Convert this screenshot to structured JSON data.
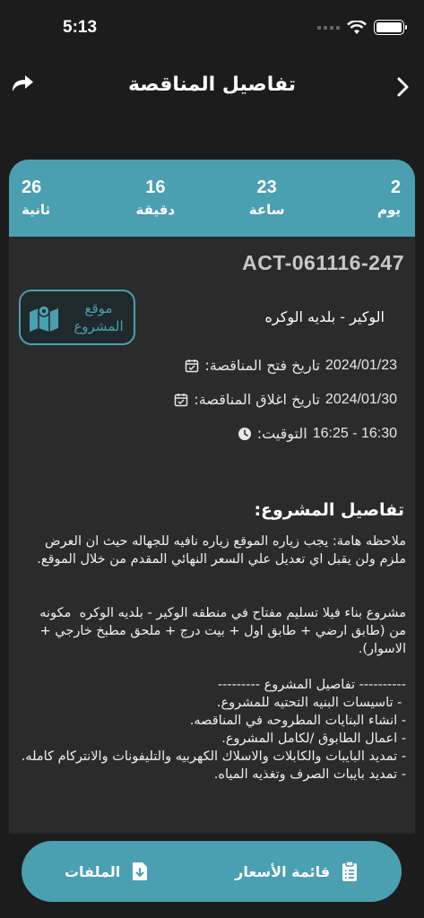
{
  "status": {
    "time": "5:13"
  },
  "nav": {
    "title": "تفاصيل المناقصة"
  },
  "countdown": [
    {
      "value": "2",
      "label": "يوم"
    },
    {
      "value": "23",
      "label": "ساعة"
    },
    {
      "value": "16",
      "label": "دقيقة"
    },
    {
      "value": "26",
      "label": "ثانية"
    }
  ],
  "tender": {
    "id": "ACT-061116-247",
    "location": "الوكير - بلديه الوكره",
    "map_button": "موقع المشروع",
    "open_date_label": "تاريخ فتح المناقصة:",
    "open_date": "2024/01/23",
    "close_date_label": "تاريخ اغلاق المناقصة:",
    "close_date": "2024/01/30",
    "timing_label": "التوقيت:",
    "timing": "16:25 - 16:30"
  },
  "details": {
    "title": "تفاصيل المشروع:",
    "body": "ملاحظه هامة: يجب زياره الموقع زياره نافيه للجهاله حيث ان العرض ملزم ولن يقبل اي تعديل علي السعر النهائي المقدم من خلال الموقع.\n\n\nمشروع بناء فيلا تسليم مفتاح في منطقه الوكير - بلديه الوكره  مكونه من (طابق ارضي + طابق اول + بيت درج + ملحق مطبخ خارجي + الاسوار).\n\n---------- تفاصيل المشروع ---------\n - تاسيسات البنيه التحتيه للمشروع.\n- انشاء البنايات المطروحه في المناقصه.\n- اعمال الطابوق /لكامل المشروع.\n- تمديد البايبات والكابلات والاسلاك الكهربيه والتليفونات والانتركام كامله.\n- تمديد بايبات الصرف وتغذيه المياه."
  },
  "bottom": {
    "prices": "قائمة الأسعار",
    "files": "الملفات"
  },
  "colors": {
    "accent": "#4a9fb0",
    "background": "#1c1c1c",
    "card": "#2b2b2b"
  }
}
